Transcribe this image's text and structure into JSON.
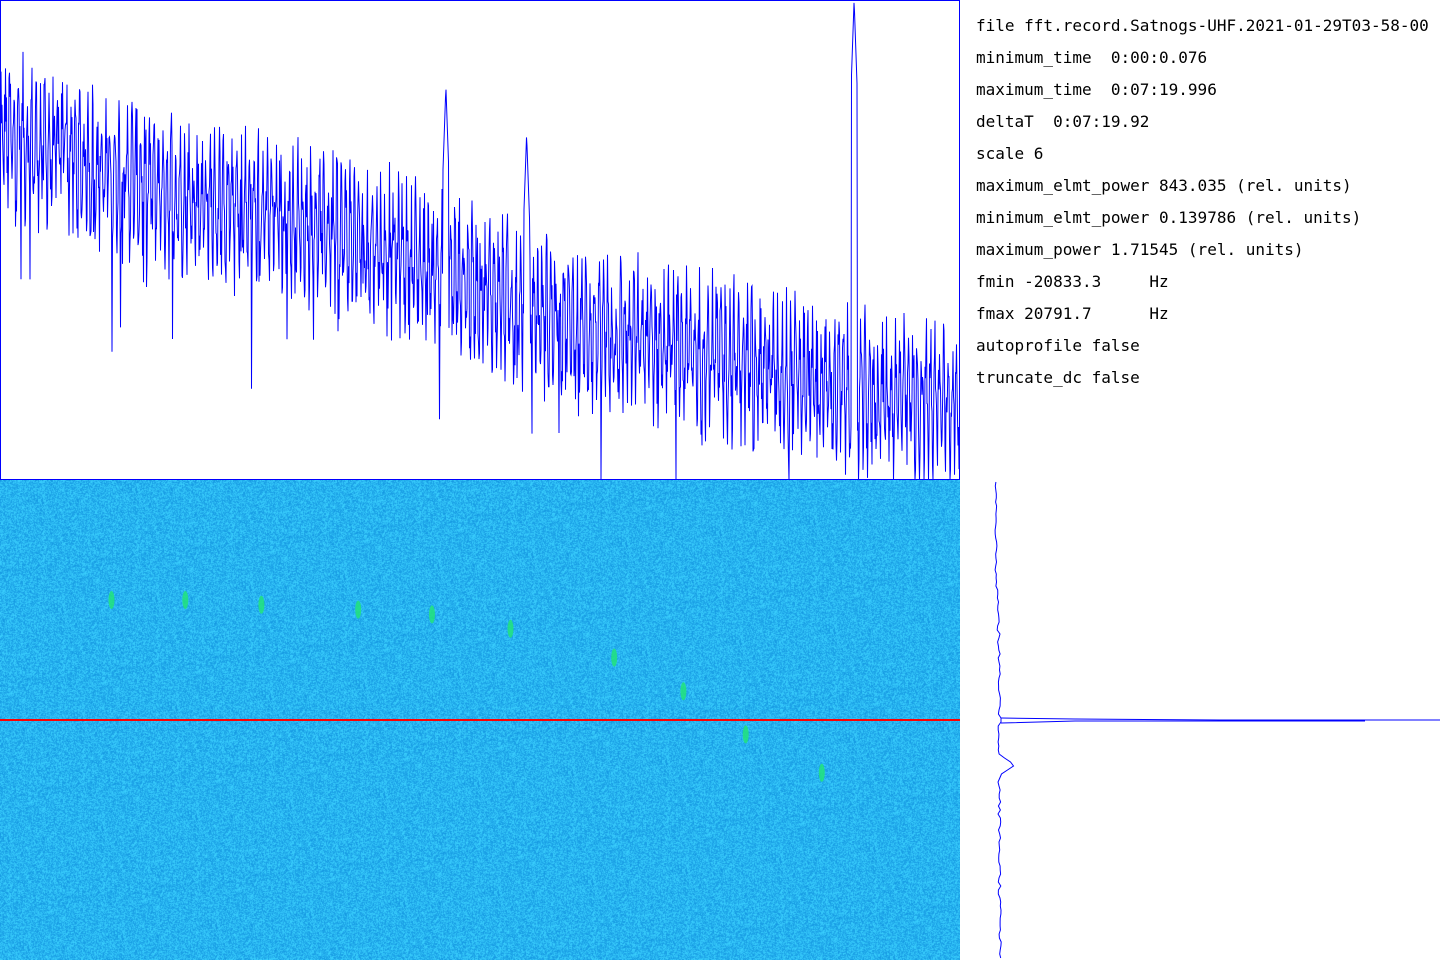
{
  "info": {
    "file": "file fft.record.Satnogs-UHF.2021-01-29T03-58-00",
    "minimum_time": "minimum_time  0:00:0.076",
    "maximum_time": "maximum_time  0:07:19.996",
    "deltaT": "deltaT  0:07:19.92",
    "scale": "scale 6",
    "maximum_elmt_power": "maximum_elmt_power 843.035 (rel. units)",
    "minimum_elmt_power": "minimum_elmt_power 0.139786 (rel. units)",
    "maximum_power": "maximum_power 1.71545 (rel. units)",
    "fmin": "fmin -20833.3     Hz",
    "fmax": "fmax 20791.7      Hz",
    "autoprofile": "autoprofile false",
    "truncate_dc": "truncate_dc false"
  },
  "colors": {
    "trace": "#0000ff",
    "waterfall_base": "#2aa8ef",
    "signal_dot": "#22e37a",
    "marker_line": "#ff0000",
    "panel_border": "#0000ff"
  },
  "chart_data": [
    {
      "type": "line",
      "description_source": "spectrum trace (top-left panel)",
      "x_range_hz": [
        -20833.3,
        20791.7
      ],
      "envelope_points": [
        [
          -20833.3,
          0.84
        ],
        [
          -16000,
          0.76
        ],
        [
          -12000,
          0.7
        ],
        [
          -8000,
          0.66
        ],
        [
          -4000,
          0.6
        ],
        [
          0,
          0.52
        ],
        [
          4000,
          0.44
        ],
        [
          8000,
          0.4
        ],
        [
          12000,
          0.36
        ],
        [
          16000,
          0.3
        ],
        [
          20791.7,
          0.28
        ]
      ],
      "peaks": [
        [
          -18000,
          0.75
        ],
        [
          -1500,
          0.82
        ],
        [
          2000,
          0.72
        ],
        [
          16200,
          1.0
        ]
      ]
    },
    {
      "type": "heatmap",
      "description_source": "waterfall (bottom-left panel)",
      "signal_dots": [
        [
          -16000,
          0.25
        ],
        [
          -12800,
          0.25
        ],
        [
          -9500,
          0.26
        ],
        [
          -5300,
          0.27
        ],
        [
          -2100,
          0.28
        ],
        [
          1300,
          0.31
        ],
        [
          5800,
          0.37
        ],
        [
          8800,
          0.44
        ],
        [
          11500,
          0.53
        ],
        [
          14800,
          0.61
        ]
      ],
      "marker_time_fraction": 0.5
    },
    {
      "type": "line",
      "description_source": "time profile (bottom-right panel)",
      "spike_fraction": 0.5
    }
  ]
}
